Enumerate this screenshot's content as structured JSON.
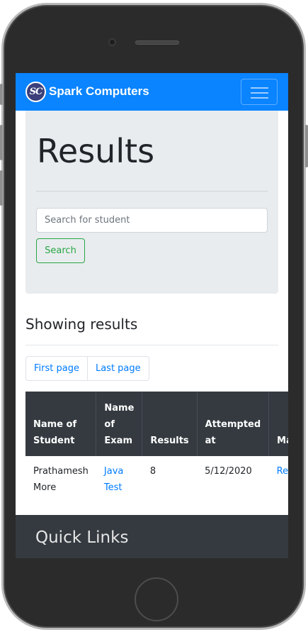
{
  "navbar": {
    "logo_text": "SC",
    "brand": "Spark Computers"
  },
  "jumbotron": {
    "title": "Results",
    "search_placeholder": "Search for student",
    "search_button": "Search"
  },
  "results": {
    "heading": "Showing results",
    "pagination": {
      "first": "First page",
      "last": "Last page"
    },
    "table": {
      "headers": [
        "Name of Student",
        "Name of Exam",
        "Results",
        "Attempted at",
        "Manage"
      ],
      "rows": [
        {
          "student": "Prathamesh More",
          "exam": "Java Test",
          "result": "8",
          "attempted_at": "5/12/2020",
          "manage": "Remove"
        }
      ]
    }
  },
  "footer": {
    "title": "Quick Links"
  },
  "colors": {
    "navbar": "#0a84ff",
    "success": "#28a745",
    "link": "#007bff",
    "table_head": "#343a40"
  }
}
